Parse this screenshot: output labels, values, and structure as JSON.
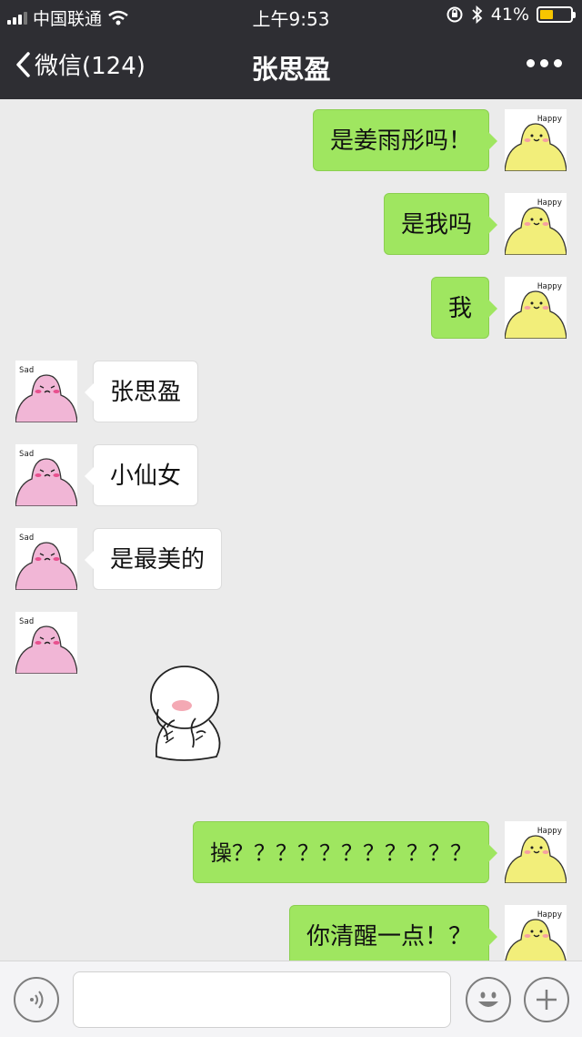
{
  "status_bar": {
    "carrier": "中国联通",
    "time": "上午9:53",
    "battery_percent": "41%",
    "battery_level": 0.41
  },
  "nav": {
    "back_label": "微信(124)",
    "title": "张思盈"
  },
  "avatars": {
    "mine_caption": "Happy",
    "theirs_caption": "Sad"
  },
  "messages": [
    {
      "side": "mine",
      "text": "是姜雨彤吗！"
    },
    {
      "side": "mine",
      "text": "是我吗"
    },
    {
      "side": "mine",
      "text": "我"
    },
    {
      "side": "theirs",
      "text": "张思盈"
    },
    {
      "side": "theirs",
      "text": "小仙女"
    },
    {
      "side": "theirs",
      "text": "是最美的"
    },
    {
      "side": "theirs",
      "type": "sticker",
      "sticker": "shy-face-sticker"
    },
    {
      "side": "mine",
      "text": "操？？？？？？？？？？？"
    },
    {
      "side": "mine",
      "text": "你清醒一点！？"
    }
  ],
  "icons": {
    "back": "chevron-left-icon",
    "more": "more-dots-icon",
    "voice": "voice-icon",
    "emoji": "emoji-icon",
    "plus": "plus-icon"
  },
  "colors": {
    "header_bg": "#2e2e33",
    "chat_bg": "#ebebeb",
    "my_bubble": "#9fe660",
    "their_bubble": "#ffffff",
    "mine_avatar": "#f2ee7a",
    "theirs_avatar": "#f1b6d6"
  }
}
